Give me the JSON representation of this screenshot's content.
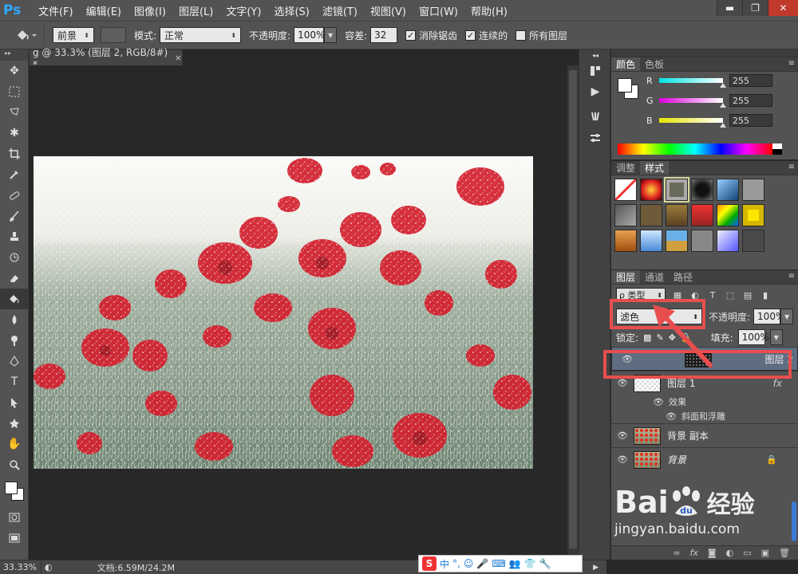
{
  "menubar": {
    "logo": "Ps",
    "items": [
      "文件(F)",
      "编辑(E)",
      "图像(I)",
      "图层(L)",
      "文字(Y)",
      "选择(S)",
      "滤镜(T)",
      "视图(V)",
      "窗口(W)",
      "帮助(H)"
    ],
    "win_min": "▬",
    "win_restore": "❐",
    "win_close": "✕"
  },
  "options": {
    "fill_source": "前景",
    "mode_label": "模式:",
    "mode_value": "正常",
    "opacity_label": "不透明度:",
    "opacity_value": "100%",
    "tolerance_label": "容差:",
    "tolerance_value": "32",
    "antialias_label": "消除锯齿",
    "contiguous_label": "连续的",
    "all_layers_label": "所有图层",
    "antialias_checked": "✓",
    "contiguous_checked": "✓"
  },
  "document": {
    "tab_title": "g @ 33.3% (图层 2, RGB/8#) *",
    "tab_close": "×"
  },
  "status": {
    "zoom": "33.33%",
    "doc_info": "文档:6.59M/24.2M"
  },
  "color_panel": {
    "tabs": [
      "颜色",
      "色板"
    ],
    "channels": [
      {
        "label": "R",
        "value": "255",
        "gradient": "#00e5e5"
      },
      {
        "label": "G",
        "value": "255",
        "gradient": "#e000e0"
      },
      {
        "label": "B",
        "value": "255",
        "gradient": "#e5e500"
      }
    ]
  },
  "styles_panel": {
    "tabs": [
      "调整",
      "样式"
    ]
  },
  "layers_panel": {
    "tabs": [
      "图层",
      "通道",
      "路径"
    ],
    "filter_type": "ρ 类型",
    "blend_mode": "滤色",
    "opacity_label": "不透明度:",
    "opacity_value": "100%",
    "lock_label": "锁定:",
    "fill_label": "填充:",
    "fill_value": "100%",
    "layers": [
      {
        "name": "图层 2",
        "selected": true
      },
      {
        "name": "图层 1",
        "fx": "fx"
      },
      {
        "name": "背景 副本"
      },
      {
        "name": "背景",
        "italic": true
      }
    ],
    "effects_label": "效果",
    "effect_item": "斜面和浮雕"
  },
  "ime": {
    "items": [
      "中",
      "°,",
      "☺",
      "🎤",
      "⌨",
      "👥",
      "👕",
      "🔧"
    ]
  },
  "watermark": {
    "brand": "Bai",
    "brand_cn": "经验",
    "url": "jingyan.baidu.com"
  },
  "colors": {
    "highlight": "#e84e4e",
    "selected_layer": "#5f6d80",
    "ui_bg": "#535353"
  }
}
